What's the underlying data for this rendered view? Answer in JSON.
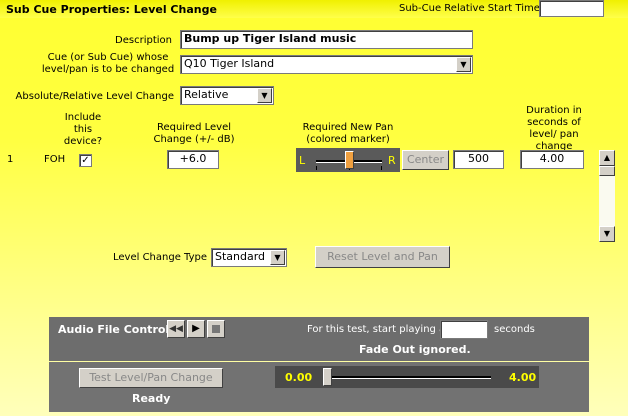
{
  "header": {
    "title": "Sub Cue Properties: Level Change",
    "start_time_label": "Sub-Cue Relative Start Time",
    "start_time_value": ""
  },
  "form": {
    "description_label": "Description",
    "description_value": "Bump up Tiger Island music",
    "cue_label": "Cue (or Sub Cue) whose level/pan is to be changed",
    "cue_value": "Q10  Tiger Island",
    "abs_rel_label": "Absolute/Relative Level Change",
    "abs_rel_value": "Relative"
  },
  "columns": {
    "include": "Include this device?",
    "level": "Required Level Change (+/- dB)",
    "pan": "Required New Pan (colored marker)",
    "duration": "Duration in seconds of level/ pan change"
  },
  "devices": [
    {
      "index": "1",
      "name": "FOH",
      "included": true,
      "level": "+6.0",
      "pan_left": "L",
      "pan_right": "R",
      "pan_value": 0.5,
      "center_label": "Center",
      "pan_numeric": "500",
      "duration": "4.00"
    }
  ],
  "level_type": {
    "label": "Level Change Type",
    "value": "Standard",
    "reset_label": "Reset Level and Pan"
  },
  "audio": {
    "label": "Audio File Control:",
    "start_text": "For this test, start playing at",
    "start_value": "",
    "seconds": "seconds",
    "fade_note": "Fade Out ignored.",
    "test_button": "Test Level/Pan Change",
    "status": "Ready",
    "pos_start": "0.00",
    "pos_end": "4.00",
    "position": 0.0
  },
  "colors": {
    "accent": "#ffff00",
    "panel": "#6d6d6d",
    "pan_bg": "#5a5a5a",
    "pan_thumb": "#f0a040",
    "value_text": "#ffff00"
  }
}
